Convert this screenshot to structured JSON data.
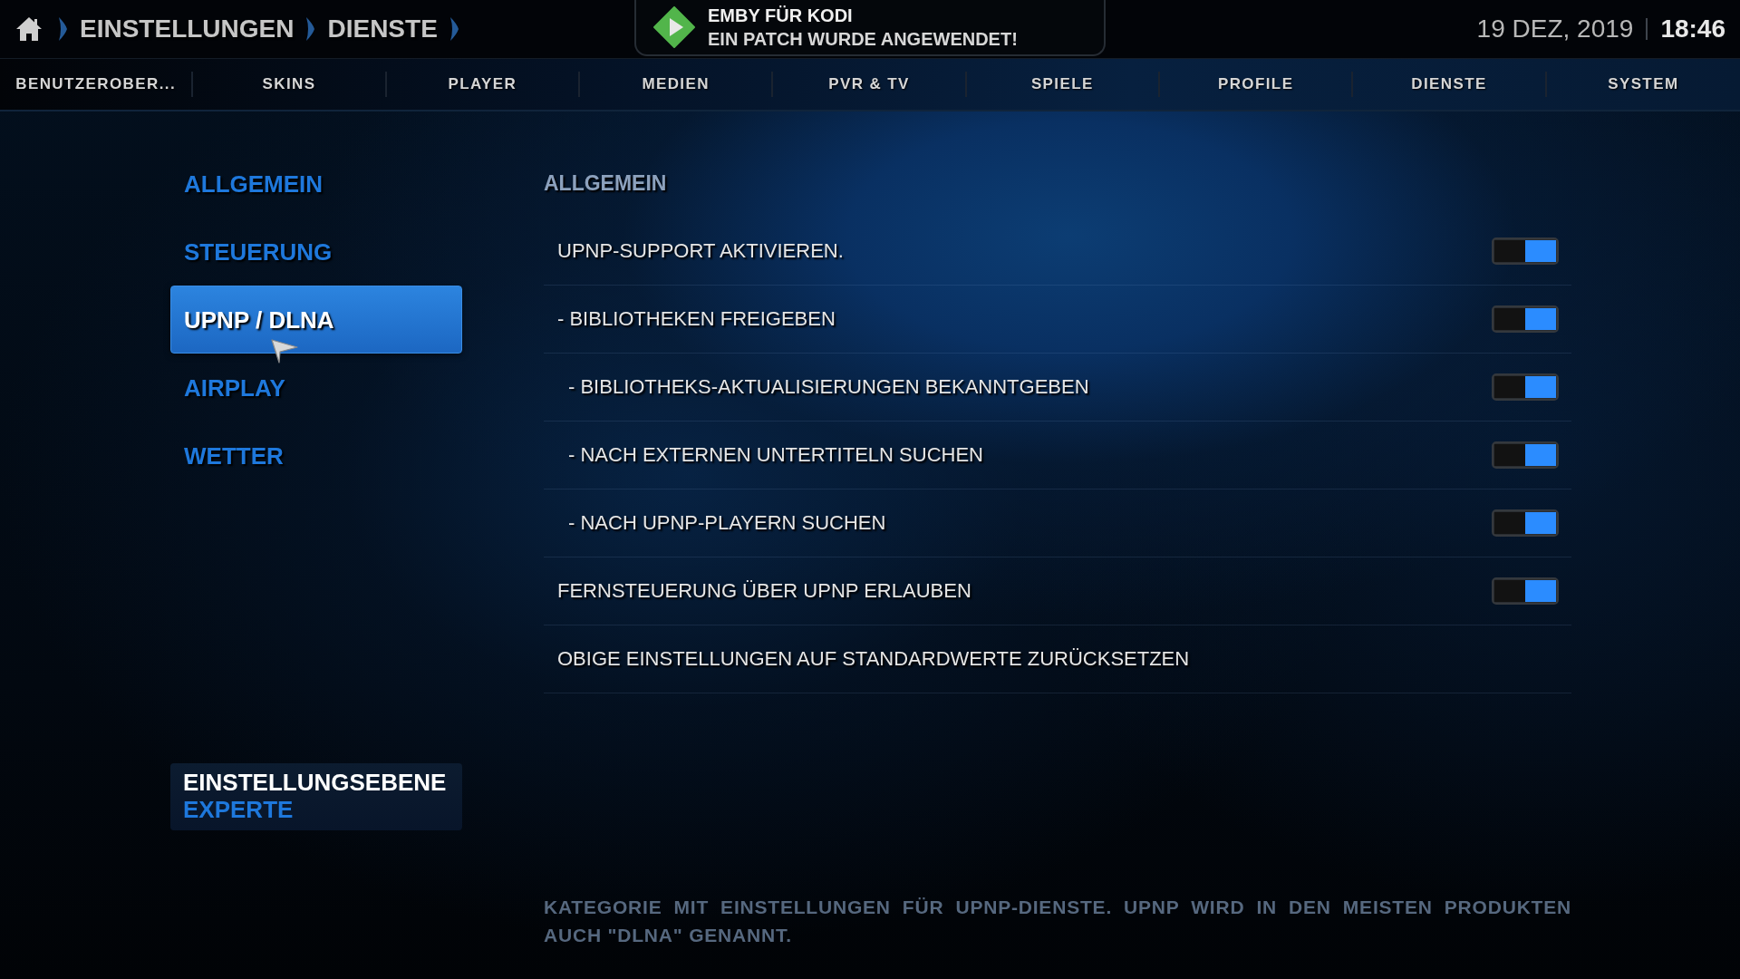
{
  "breadcrumb": [
    "EINSTELLUNGEN",
    "DIENSTE"
  ],
  "notification": {
    "title": "EMBY FÜR KODI",
    "message": "EIN PATCH WURDE ANGEWENDET!"
  },
  "clock": {
    "date": "19 DEZ, 2019",
    "time": "18:46"
  },
  "tabs": [
    {
      "label": "BENUTZEROBER..."
    },
    {
      "label": "SKINS"
    },
    {
      "label": "PLAYER"
    },
    {
      "label": "MEDIEN"
    },
    {
      "label": "PVR & TV"
    },
    {
      "label": "SPIELE"
    },
    {
      "label": "PROFILE"
    },
    {
      "label": "DIENSTE"
    },
    {
      "label": "SYSTEM"
    }
  ],
  "sidebar": {
    "items": [
      {
        "label": "ALLGEMEIN",
        "selected": false
      },
      {
        "label": "STEUERUNG",
        "selected": false
      },
      {
        "label": "UPNP / DLNA",
        "selected": true
      },
      {
        "label": "AIRPLAY",
        "selected": false
      },
      {
        "label": "WETTER",
        "selected": false
      }
    ]
  },
  "settings_level": {
    "label": "EINSTELLUNGSEBENE",
    "value": "EXPERTE"
  },
  "section_title": "ALLGEMEIN",
  "settings": [
    {
      "kind": "toggle",
      "label": "UPNP-SUPPORT AKTIVIEREN.",
      "on": true,
      "children": [
        {
          "kind": "toggle",
          "label": "- BIBLIOTHEKEN FREIGEBEN",
          "on": true,
          "children": [
            {
              "kind": "toggle",
              "label": "- BIBLIOTHEKS-AKTUALISIERUNGEN BEKANNTGEBEN",
              "on": true
            },
            {
              "kind": "toggle",
              "label": "- NACH EXTERNEN UNTERTITELN SUCHEN",
              "on": true
            },
            {
              "kind": "toggle",
              "label": "- NACH UPNP-PLAYERN SUCHEN",
              "on": true
            }
          ]
        }
      ]
    },
    {
      "kind": "toggle",
      "label": "FERNSTEUERUNG ÜBER UPNP ERLAUBEN",
      "on": true
    },
    {
      "kind": "action",
      "label": "OBIGE EINSTELLUNGEN AUF STANDARDWERTE ZURÜCKSETZEN"
    }
  ],
  "description": "KATEGORIE MIT EINSTELLUNGEN FÜR UPNP-DIENSTE. UPNP WIRD IN DEN MEISTEN PRODUKTEN AUCH \"DLNA\" GENANNT."
}
